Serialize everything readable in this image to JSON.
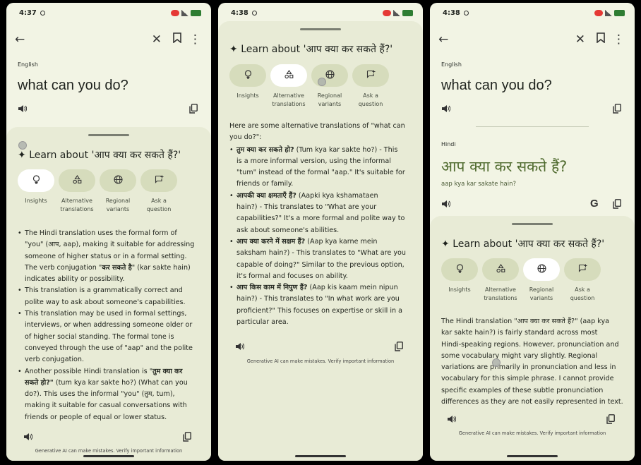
{
  "icons": {
    "back": "←",
    "close": "✕",
    "bookmark": "🔖",
    "more": "⋮",
    "speaker": "🔊",
    "copy": "❐",
    "google": "G",
    "sparkle": "✦",
    "insights": "💡",
    "alternative": "△",
    "regional": "🌐",
    "ask": "✚"
  },
  "chips": {
    "insights": "Insights",
    "alternative_1": "Alternative",
    "alternative_2": "translations",
    "regional_1": "Regional",
    "regional_2": "variants",
    "ask_1": "Ask a",
    "ask_2": "question"
  },
  "disclaimer": "Generative AI can make mistakes. Verify important information",
  "phone1": {
    "time": "4:37",
    "lang": "English",
    "source": "what can you do?",
    "learn": "Learn about 'आप क्या कर सकते हैं?'",
    "lines": [
      "The Hindi translation uses the formal form of",
      "\"you\" (आप, aap), making it suitable for addressing",
      "someone of higher status or in a formal setting.",
      "The verb conjugation \"",
      "कर सकते है",
      "\" (kar sakte hain)",
      "indicates ability or possibility.",
      "This translation is a grammatically correct and",
      "polite way to ask about someone's capabilities.",
      "This translation may be used in formal settings,",
      "interviews, or when addressing someone older or",
      "of higher social standing.  The formal tone is",
      "conveyed through the use of \"aap\" and the polite",
      "verb conjugation.",
      "Another possible Hindi translation is \"",
      "तुम क्या कर",
      "सकते हो?\"",
      " (tum kya kar sakte ho?) (What can you",
      "do?). This uses the informal \"you\" (तुम, tum),",
      "making it suitable for casual conversations with",
      "friends or people of equal or lower status."
    ]
  },
  "phone2": {
    "time": "4:38",
    "learn": "Learn about 'आप क्या कर सकते हैं?'",
    "intro_1": "Here are some alternative translations of \"what can",
    "intro_2": "you do?\":",
    "items": [
      {
        "bold": "तुम क्या कर सकते हो?",
        "rest": " (Tum kya kar sakte ho?) - This",
        "l2": "is a more informal version, using the informal",
        "l3": "\"tum\" instead of the formal \"aap.\"  It's suitable for",
        "l4": "friends or family."
      },
      {
        "bold": "आपकी क्या क्षमताएँ हैं?",
        "rest": " (Aapki kya kshamataen",
        "l2": "hain?) - This translates to \"What are your",
        "l3": "capabilities?\" It's a more formal and polite way to",
        "l4": "ask about someone's abilities."
      },
      {
        "bold": "आप क्या करने में सक्षम हैं?",
        "rest": " (Aap kya karne mein",
        "l2": "saksham hain?) - This translates to \"What are you",
        "l3": "capable of doing?\"  Similar to the previous option,",
        "l4": "it's formal and focuses on ability."
      },
      {
        "bold": "आप किस काम में निपुण हैं?",
        "rest": " (Aap kis kaam mein nipun",
        "l2": "hain?) - This translates to \"In what work are you",
        "l3": "proficient?\" This focuses on expertise or skill in a",
        "l4": "particular area."
      }
    ]
  },
  "phone3": {
    "time": "4:38",
    "lang_src": "English",
    "source": "what can you do?",
    "lang_tgt": "Hindi",
    "hindi": "आप क्या कर सकते हैं?",
    "translit": "aap kya kar sakate hain?",
    "learn": "Learn about 'आप क्या कर सकते हैं?'",
    "lines": [
      "The Hindi translation \"आप क्या कर सकते हैं?\" (aap kya",
      "kar sakte hain?) is fairly standard across most",
      "Hindi-speaking regions.  However, pronunciation and",
      "some vocabulary might vary slightly.  Regional",
      "variations are primarily in pronunciation and less in",
      "vocabulary for this simple phrase.  I cannot provide",
      "specific examples of these subtle pronunciation",
      "differences as they are not easily represented in text."
    ]
  }
}
